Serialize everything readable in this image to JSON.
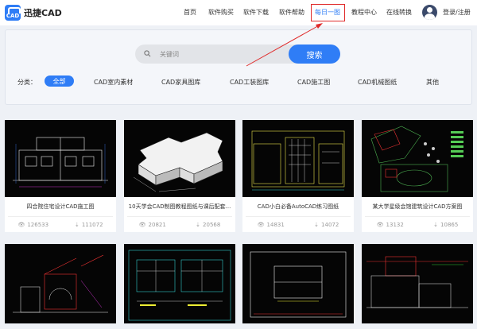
{
  "brand": {
    "name": "迅捷CAD",
    "badge": "CAD"
  },
  "nav": {
    "items": [
      "首页",
      "软件购买",
      "软件下载",
      "软件帮助",
      "每日一图",
      "教程中心",
      "在线转换"
    ],
    "active": "每日一图",
    "login": "登录/注册"
  },
  "search": {
    "placeholder": "关键词",
    "button": "搜索"
  },
  "categories": {
    "label": "分类：",
    "items": [
      "全部",
      "CAD室内素材",
      "CAD家具图库",
      "CAD工装图库",
      "CAD施工图",
      "CAD机械图纸",
      "其他"
    ],
    "active": "全部"
  },
  "cards": [
    {
      "title": "四合院住宅设计CAD施工图",
      "views": "126533",
      "downloads": "111072"
    },
    {
      "title": "10天学会CAD制图教程图纸与课后配套...",
      "views": "20821",
      "downloads": "20568"
    },
    {
      "title": "CAD小白必备AutoCAD练习图纸",
      "views": "14831",
      "downloads": "14072"
    },
    {
      "title": "某大学星级会馆建筑设计CAD方案图",
      "views": "13132",
      "downloads": "10865"
    }
  ],
  "colors": {
    "accent": "#2f7df6",
    "annotation": "#e02b2b"
  }
}
